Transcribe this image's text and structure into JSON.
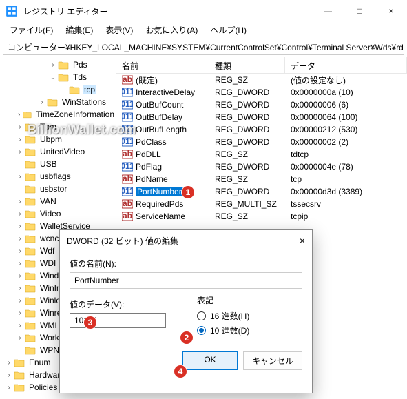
{
  "window": {
    "title": "レジストリ エディター",
    "minimize": "—",
    "maximize": "□",
    "close": "×"
  },
  "menu": {
    "file": "ファイル(F)",
    "edit": "編集(E)",
    "view": "表示(V)",
    "favorites": "お気に入り(A)",
    "help": "ヘルプ(H)"
  },
  "path": "コンピューター¥HKEY_LOCAL_MACHINE¥SYSTEM¥CurrentControlSet¥Control¥Terminal Server¥Wds¥rdpwd¥Tds¥tcp",
  "tree": [
    {
      "indent": 3,
      "chev": ">",
      "label": "Pds"
    },
    {
      "indent": 3,
      "chev": "v",
      "label": "Tds"
    },
    {
      "indent": 4,
      "chev": "",
      "label": "tcp",
      "selected": true
    },
    {
      "indent": 2,
      "chev": ">",
      "label": "WinStations"
    },
    {
      "indent": 0,
      "chev": ">",
      "label": "TimeZoneInformation"
    },
    {
      "indent": 0,
      "chev": ">",
      "label": "Tpm"
    },
    {
      "indent": 0,
      "chev": ">",
      "label": "Ubpm"
    },
    {
      "indent": 0,
      "chev": ">",
      "label": "UnitedVideo"
    },
    {
      "indent": 0,
      "chev": "",
      "label": "USB"
    },
    {
      "indent": 0,
      "chev": ">",
      "label": "usbflags"
    },
    {
      "indent": 0,
      "chev": "",
      "label": "usbstor"
    },
    {
      "indent": 0,
      "chev": ">",
      "label": "VAN"
    },
    {
      "indent": 0,
      "chev": ">",
      "label": "Video"
    },
    {
      "indent": 0,
      "chev": ">",
      "label": "WalletService"
    },
    {
      "indent": 0,
      "chev": ">",
      "label": "wcncsvc"
    },
    {
      "indent": 0,
      "chev": ">",
      "label": "Wdf"
    },
    {
      "indent": 0,
      "chev": ">",
      "label": "WDI"
    },
    {
      "indent": 0,
      "chev": ">",
      "label": "WindowsT"
    },
    {
      "indent": 0,
      "chev": ">",
      "label": "WinInit"
    },
    {
      "indent": 0,
      "chev": ">",
      "label": "Winlogon"
    },
    {
      "indent": 0,
      "chev": ">",
      "label": "Winresume"
    },
    {
      "indent": 0,
      "chev": ">",
      "label": "WMI"
    },
    {
      "indent": 0,
      "chev": ">",
      "label": "Workplace"
    },
    {
      "indent": 0,
      "chev": "",
      "label": "WPN"
    },
    {
      "indent": -1,
      "chev": ">",
      "label": "Enum"
    },
    {
      "indent": -1,
      "chev": ">",
      "label": "Hardware P"
    },
    {
      "indent": -1,
      "chev": ">",
      "label": "Policies"
    }
  ],
  "list": {
    "headers": {
      "name": "名前",
      "type": "種類",
      "data": "データ"
    },
    "rows": [
      {
        "icon": "sz",
        "name": "(既定)",
        "type": "REG_SZ",
        "data": "(値の設定なし)"
      },
      {
        "icon": "dw",
        "name": "InteractiveDelay",
        "type": "REG_DWORD",
        "data": "0x0000000a (10)"
      },
      {
        "icon": "dw",
        "name": "OutBufCount",
        "type": "REG_DWORD",
        "data": "0x00000006 (6)"
      },
      {
        "icon": "dw",
        "name": "OutBufDelay",
        "type": "REG_DWORD",
        "data": "0x00000064 (100)"
      },
      {
        "icon": "dw",
        "name": "OutBufLength",
        "type": "REG_DWORD",
        "data": "0x00000212 (530)"
      },
      {
        "icon": "dw",
        "name": "PdClass",
        "type": "REG_DWORD",
        "data": "0x00000002 (2)"
      },
      {
        "icon": "sz",
        "name": "PdDLL",
        "type": "REG_SZ",
        "data": "tdtcp"
      },
      {
        "icon": "dw",
        "name": "PdFlag",
        "type": "REG_DWORD",
        "data": "0x0000004e (78)"
      },
      {
        "icon": "sz",
        "name": "PdName",
        "type": "REG_SZ",
        "data": "tcp"
      },
      {
        "icon": "dw",
        "name": "PortNumber",
        "type": "REG_DWORD",
        "data": "0x00000d3d (3389)",
        "selected": true
      },
      {
        "icon": "sz",
        "name": "RequiredPds",
        "type": "REG_MULTI_SZ",
        "data": "tssecsrv"
      },
      {
        "icon": "sz",
        "name": "ServiceName",
        "type": "REG_SZ",
        "data": "tcpip"
      }
    ]
  },
  "dialog": {
    "title": "DWORD (32 ビット) 値の編集",
    "close": "×",
    "name_label": "値の名前(N):",
    "name_value": "PortNumber",
    "data_label": "値のデータ(V):",
    "data_value": "10241",
    "radix_label": "表記",
    "radix_hex": "16 進数(H)",
    "radix_dec": "10 進数(D)",
    "ok": "OK",
    "cancel": "キャンセル"
  },
  "markers": {
    "m1": "1",
    "m2": "2",
    "m3": "3",
    "m4": "4"
  },
  "watermark": "BillionWallet.com"
}
